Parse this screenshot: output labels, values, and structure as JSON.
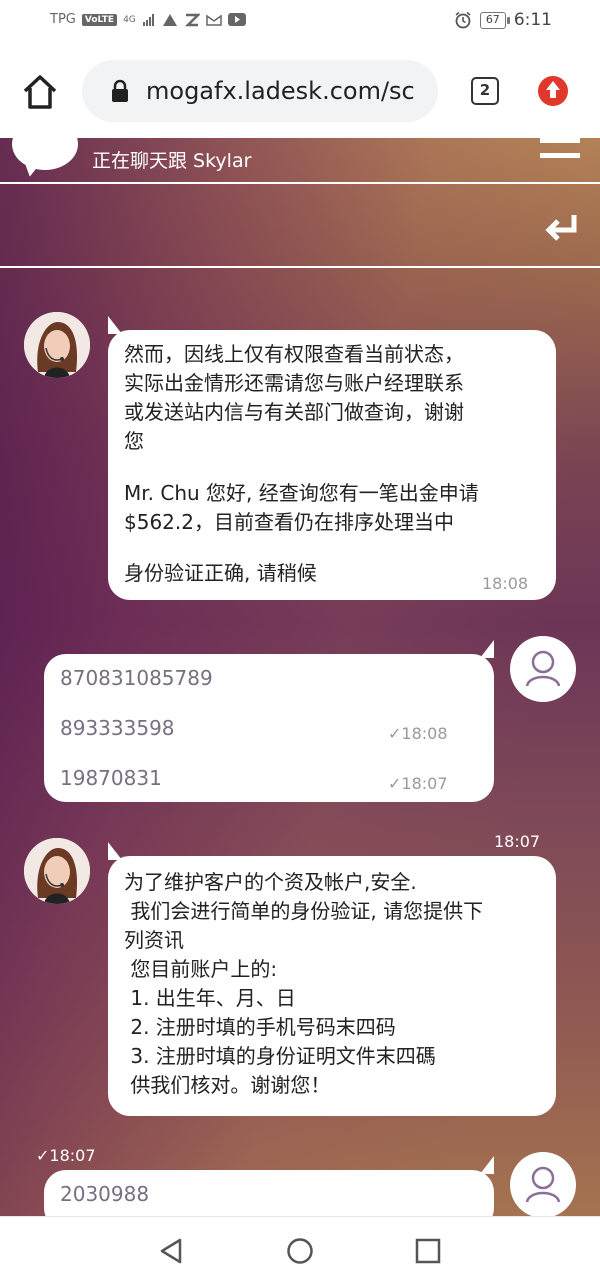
{
  "status_bar": {
    "carrier": "TPG",
    "volte": "VoLTE",
    "net": "4G",
    "battery": "67",
    "time": "6:11"
  },
  "browser": {
    "url": "mogafx.ladesk.com/sc",
    "tab_count": "2"
  },
  "chat": {
    "header_status": "正在聊天跟 Skylar",
    "messages": [
      {
        "from": "agent",
        "paragraphs": [
          [
            "然而，因线上仅有权限查看当前状态，",
            "实际出金情形还需请您与账户经理联系",
            "或发送站内信与有关部门做查询，谢谢",
            "您"
          ],
          [
            "Mr. Chu 您好, 经查询您有一笔出金申请",
            "$562.2，目前查看仍在排序处理当中"
          ],
          [
            "身份验证正确, 请稍候"
          ]
        ],
        "time": "18:08"
      },
      {
        "from": "user",
        "lines": [
          {
            "text": "870831085789",
            "time": ""
          },
          {
            "text": "893333598",
            "time": "✓18:08"
          },
          {
            "text": "19870831",
            "time": "✓18:07"
          }
        ]
      },
      {
        "from": "agent",
        "time_above": "18:07",
        "lines": [
          "为了维护客户的个资及帐户,安全.",
          " 我们会进行简单的身份验证, 请您提供下",
          "列资讯",
          " 您目前账户上的:",
          " 1. 出生年、月、日",
          " 2. 注册时填的手机号码末四码",
          " 3. 注册时填的身份证明文件末四碼",
          " 供我们核对。谢谢您！"
        ]
      },
      {
        "from": "user",
        "time_above": "✓18:07",
        "lines": [
          {
            "text": "2030988",
            "time": ""
          }
        ]
      }
    ]
  }
}
